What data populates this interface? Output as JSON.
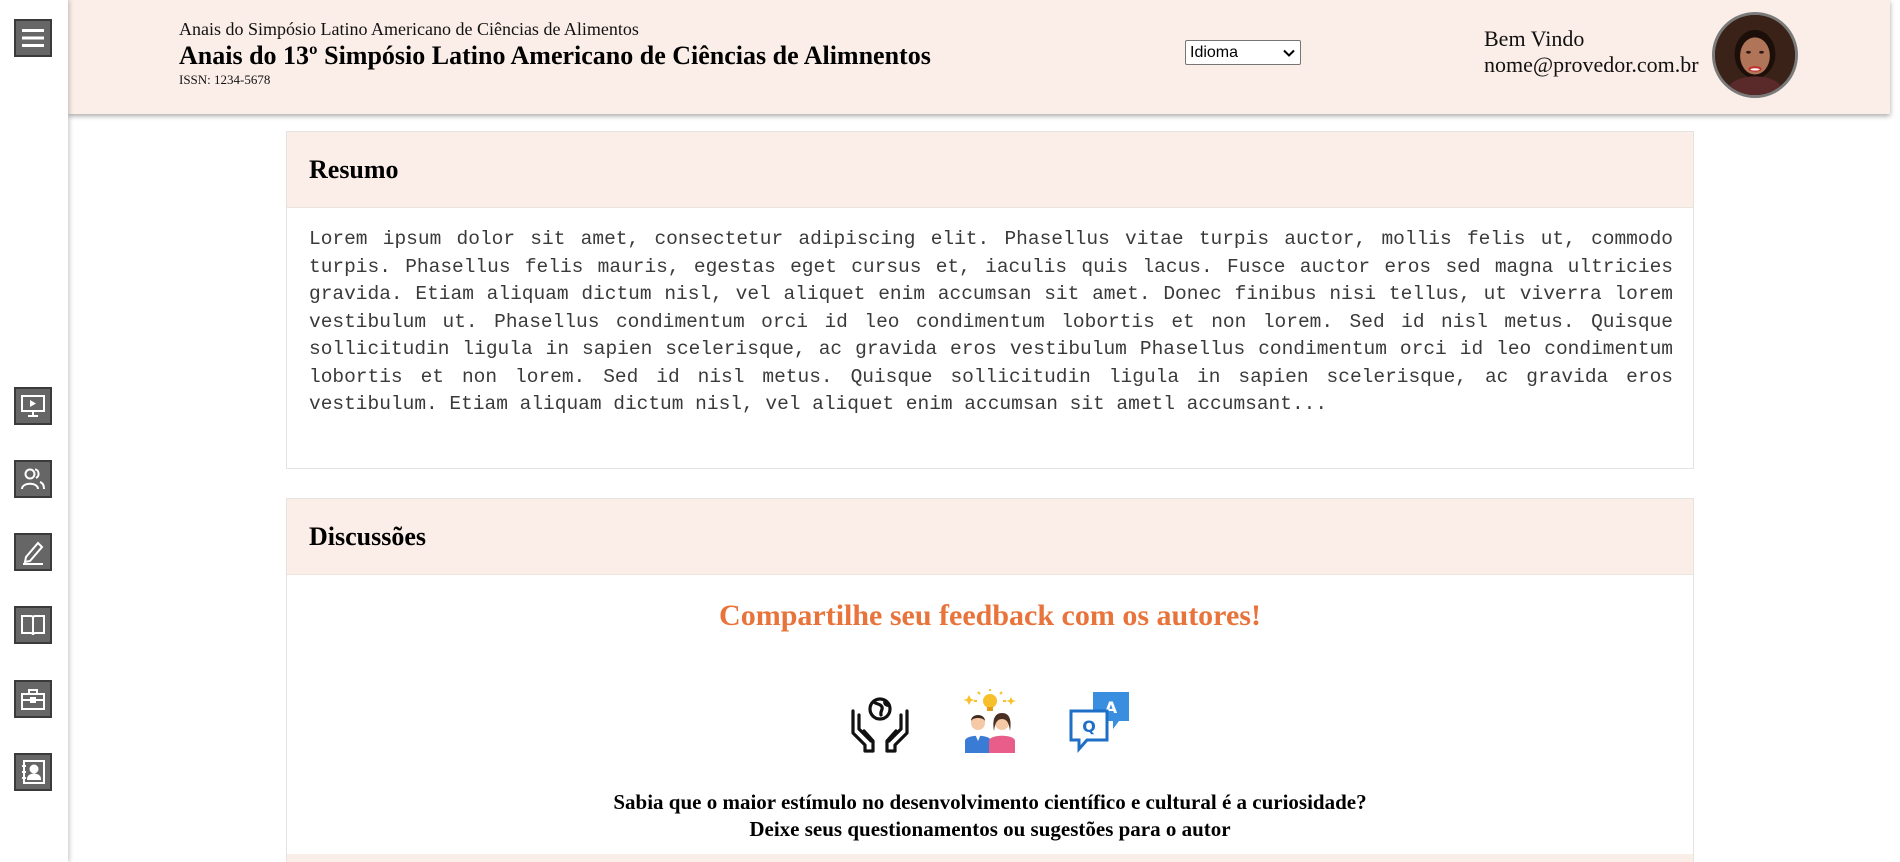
{
  "header": {
    "subtitle": "Anais do Simpósio Latino Americano de Ciências de Alimentos",
    "title": "Anais do 13º Simpósio Latino Americano de Ciências de Alimnentos",
    "issn": "ISSN: 1234-5678",
    "language_select": "Idioma",
    "welcome": "Bem Vindo",
    "email": "nome@provedor.com.br"
  },
  "sidebar": {
    "items": [
      {
        "icon": "menu-icon"
      },
      {
        "icon": "presentation-icon"
      },
      {
        "icon": "users-icon"
      },
      {
        "icon": "edit-icon"
      },
      {
        "icon": "book-icon"
      },
      {
        "icon": "briefcase-icon"
      },
      {
        "icon": "contacts-icon"
      }
    ]
  },
  "resumo": {
    "heading": "Resumo",
    "text": "Lorem ipsum dolor sit amet, consectetur adipiscing elit. Phasellus vitae turpis auctor, mollis felis ut, commodo turpis. Phasellus felis mauris, egestas eget cursus et, iaculis quis lacus. Fusce auctor eros sed magna ultricies gravida. Etiam aliquam dictum nisl, vel aliquet enim accumsan sit amet. Donec finibus nisi tellus, ut viverra lorem vestibulum ut. Phasellus condimentum orci id leo condimentum lobortis et non lorem. Sed id nisl metus. Quisque sollicitudin ligula in sapien scelerisque, ac gravida eros vestibulum Phasellus condimentum orci id leo condimentum lobortis et non lorem. Sed id nisl metus. Quisque sollicitudin ligula in sapien scelerisque, ac gravida eros vestibulum. Etiam aliquam dictum nisl, vel aliquet enim accumsan sit ametl accumsant..."
  },
  "discussoes": {
    "heading": "Discussões",
    "feedback_title": "Compartilhe seu feedback com os autores!",
    "icons": [
      "hands-globe-icon",
      "people-idea-icon",
      "qa-chat-icon"
    ],
    "line1": "Sabia que o maior estímulo no desenvolvimento científico e cultural é a curiosidade?",
    "line2": "Deixe seus questionamentos ou sugestões para o autor"
  },
  "colors": {
    "header_bg": "#fbeee8",
    "accent": "#e8743b",
    "sidebar_button": "#666666"
  }
}
